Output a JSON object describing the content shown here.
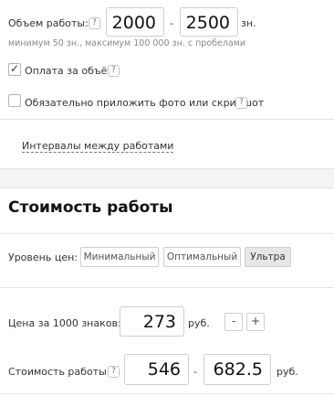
{
  "volume": {
    "label": "Объем работы:",
    "help": "?",
    "min_value": "2000",
    "separator": "-",
    "max_value": "2500",
    "unit": "зн.",
    "hint": "минимум 50 зн., максимум 100 000 зн. с пробелами"
  },
  "options": {
    "pay_by_volume": {
      "label": "Оплата за объём",
      "help": "?",
      "checked": true,
      "check_mark": "✓"
    },
    "attach_photo": {
      "label": "Обязательно приложить фото или скриншот",
      "help": "?",
      "checked": false
    }
  },
  "intervals_link": "Интервалы между работами",
  "cost_section": {
    "title": "Стоимость работы",
    "price_level_label": "Уровень цен:",
    "price_levels": [
      "Минимальный",
      "Оптимальный",
      "Ультра"
    ],
    "selected_level": "Ультра",
    "per1000": {
      "label": "Цена за 1000 знаков:",
      "value": "273",
      "unit": "руб.",
      "minus": "-",
      "plus": "+"
    },
    "total": {
      "label": "Стоимость работы:",
      "help": "?",
      "min_value": "546",
      "separator": "-",
      "max_value": "682.5",
      "unit": "руб."
    }
  },
  "colors": {
    "section_divider": "#e3e3e3",
    "active_segment": "#e6e6e6",
    "input_border": "#cfcfcf"
  }
}
